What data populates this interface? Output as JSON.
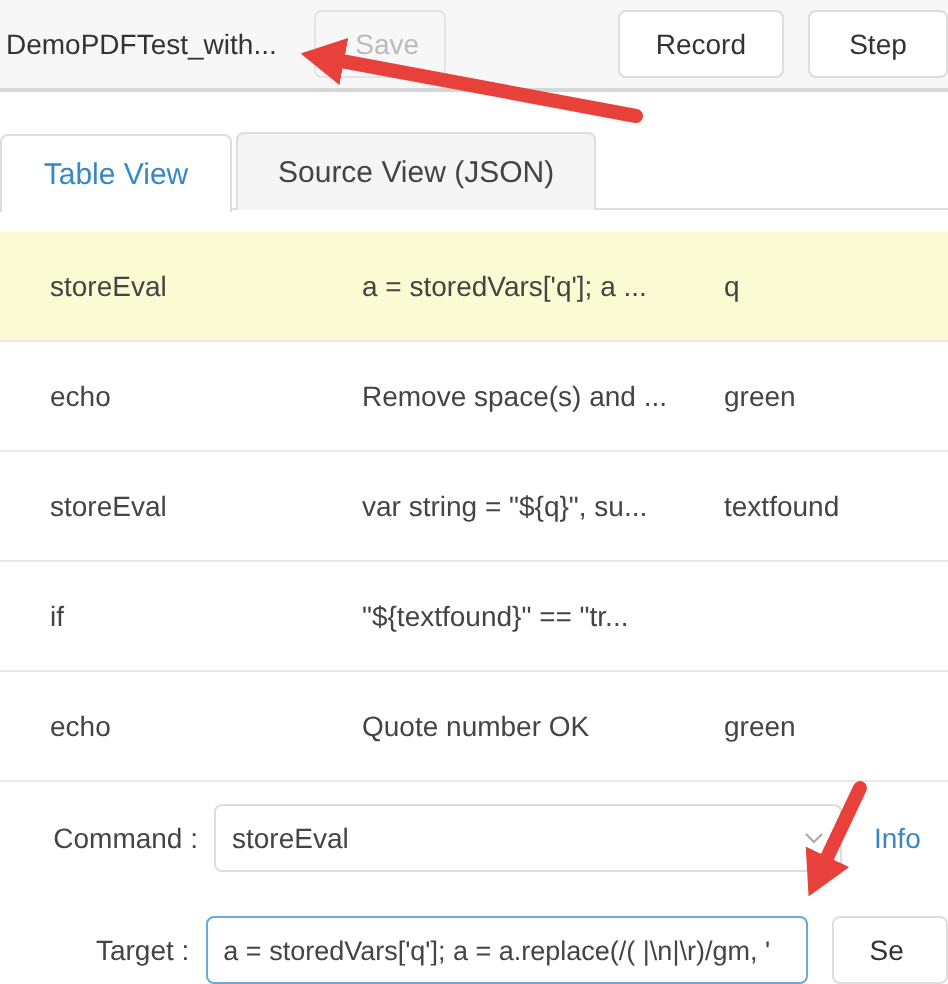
{
  "toolbar": {
    "file_name": "DemoPDFTest_with...",
    "buttons": [
      {
        "label": "Save",
        "disabled": true
      },
      {
        "label": "Record",
        "disabled": false
      },
      {
        "label": "Step",
        "disabled": false
      }
    ]
  },
  "tabs": [
    {
      "label": "Table View",
      "selected": true
    },
    {
      "label": "Source View (JSON)",
      "selected": false
    }
  ],
  "table": {
    "rows": [
      {
        "command": "storeEval",
        "target": "a = storedVars['q']; a ...",
        "value": "q",
        "selected": true
      },
      {
        "command": "echo",
        "target": "Remove space(s) and ...",
        "value": "green",
        "selected": false
      },
      {
        "command": "storeEval",
        "target": "var string = \"${q}\", su...",
        "value": "textfound",
        "selected": false
      },
      {
        "command": "if",
        "target": "\"${textfound}\" == \"tr...",
        "selected": false
      },
      {
        "command": "echo",
        "target": "Quote number OK",
        "value": "green",
        "selected": false
      }
    ]
  },
  "editor": {
    "command": {
      "label": "Command :",
      "value": "storeEval",
      "link": "Info"
    },
    "target": {
      "label": "Target :",
      "value": "a = storedVars['q']; a = a.replace(/( |\\n|\\r)/gm, '",
      "button": "Se"
    }
  }
}
